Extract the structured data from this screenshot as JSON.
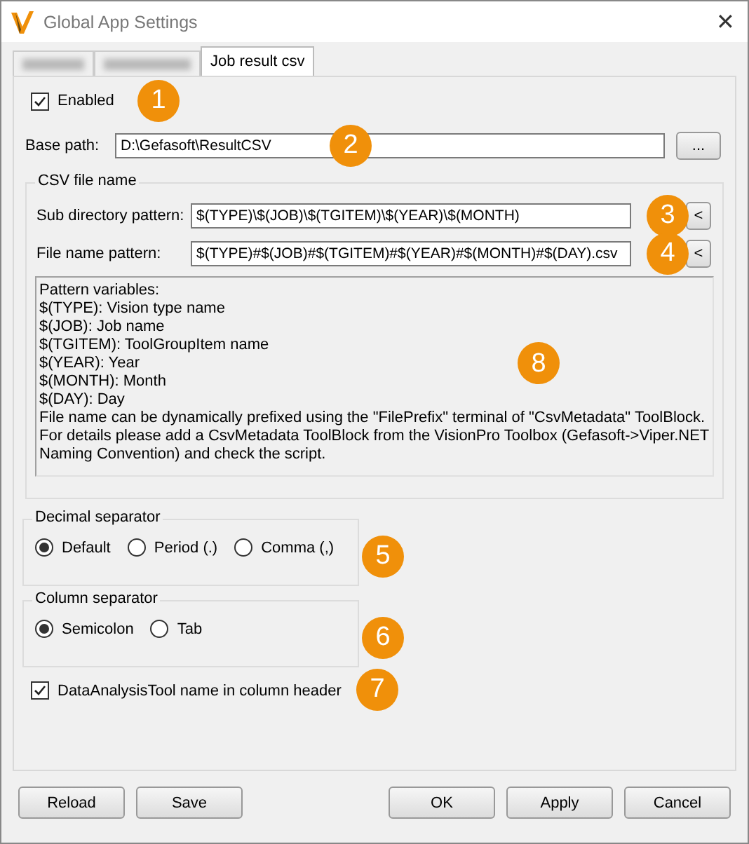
{
  "window": {
    "title": "Global App Settings",
    "close": "✕"
  },
  "tabs": [
    {
      "kind": "redacted",
      "selected": false
    },
    {
      "kind": "redacted",
      "selected": false
    },
    {
      "kind": "tab",
      "label": "Job result csv",
      "selected": true
    }
  ],
  "enabled": {
    "label": "Enabled",
    "checked": true,
    "callout": "1"
  },
  "base_path": {
    "label": "Base path:",
    "value": "D:\\Gefasoft\\ResultCSV",
    "browse": "...",
    "callout": "2"
  },
  "csv_file_name": {
    "title": "CSV file name",
    "fields": [
      {
        "label": "Sub directory pattern:",
        "value": "$(TYPE)\\$(JOB)\\$(TGITEM)\\$(YEAR)\\$(MONTH)",
        "button": "<",
        "callout": "3"
      },
      {
        "label": "File name pattern:",
        "value": "$(TYPE)#$(JOB)#$(TGITEM)#$(YEAR)#$(MONTH)#$(DAY).csv",
        "button": "<",
        "callout": "4"
      }
    ],
    "info_lines": [
      "Pattern variables:",
      "$(TYPE): Vision type name",
      "$(JOB): Job name",
      "$(TGITEM): ToolGroupItem name",
      "$(YEAR): Year",
      "$(MONTH): Month",
      "$(DAY): Day",
      "File name can be dynamically prefixed using the \"FilePrefix\" terminal of \"CsvMetadata\" ToolBlock.",
      "For details please add a CsvMetadata ToolBlock from the VisionPro Toolbox (Gefasoft->Viper.NET Naming Convention) and check the script."
    ],
    "info_callout": "8"
  },
  "decimal_separator": {
    "title": "Decimal separator",
    "callout": "5",
    "options": [
      {
        "label": "Default",
        "selected": true
      },
      {
        "label": "Period (.)",
        "selected": false
      },
      {
        "label": "Comma (,)",
        "selected": false
      }
    ]
  },
  "column_separator": {
    "title": "Column separator",
    "callout": "6",
    "options": [
      {
        "label": "Semicolon",
        "selected": true
      },
      {
        "label": "Tab",
        "selected": false
      }
    ]
  },
  "column_header": {
    "label": "DataAnalysisTool name in column header",
    "checked": true,
    "callout": "7"
  },
  "buttons_left": [
    "Reload",
    "Save"
  ],
  "buttons_right": [
    "OK",
    "Apply",
    "Cancel"
  ]
}
